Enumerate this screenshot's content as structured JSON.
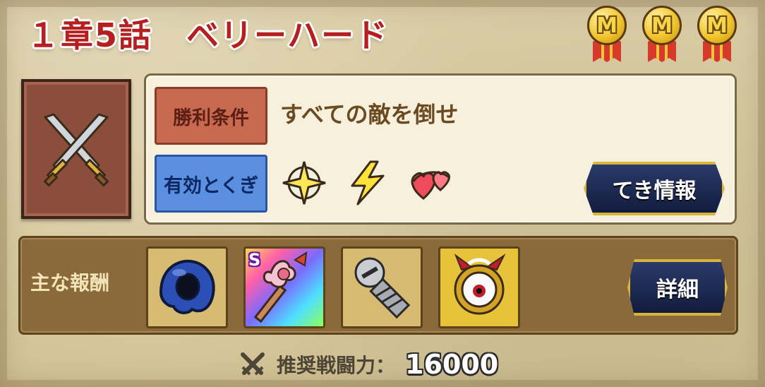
{
  "stage": {
    "title": "１章5話　ベリーハード"
  },
  "medals": [
    {
      "letter": "M",
      "icon": "medal-icon"
    },
    {
      "letter": "M",
      "icon": "medal-icon"
    },
    {
      "letter": "M",
      "icon": "medal-icon"
    }
  ],
  "battle": {
    "icon": "crossed-swords-icon"
  },
  "conditions": {
    "victory_label": "勝利条件",
    "victory_text": "すべての敵を倒せ",
    "effective_label": "有効とくぎ",
    "effective_icons": [
      "light-burst-icon",
      "lightning-icon",
      "hearts-icon"
    ],
    "enemy_info_button": "てき情報"
  },
  "rewards": {
    "label": "主な報酬",
    "items": [
      {
        "icon": "blue-slime-helmet-icon",
        "badge": ""
      },
      {
        "icon": "heart-axe-icon",
        "badge": "S"
      },
      {
        "icon": "screw-icon",
        "badge": ""
      },
      {
        "icon": "eyeball-emblem-icon",
        "badge": ""
      }
    ],
    "detail_button": "詳細"
  },
  "recommended_power": {
    "icon": "crossed-swords-small-icon",
    "label": "推奨戦闘力：",
    "value": "16000"
  },
  "colors": {
    "title_red": "#b51f1f",
    "victory_tag": "#c76a4f",
    "effective_tag": "#5b8fe0",
    "button_navy": "#121c3d",
    "button_gold_border": "#d9b43a"
  }
}
